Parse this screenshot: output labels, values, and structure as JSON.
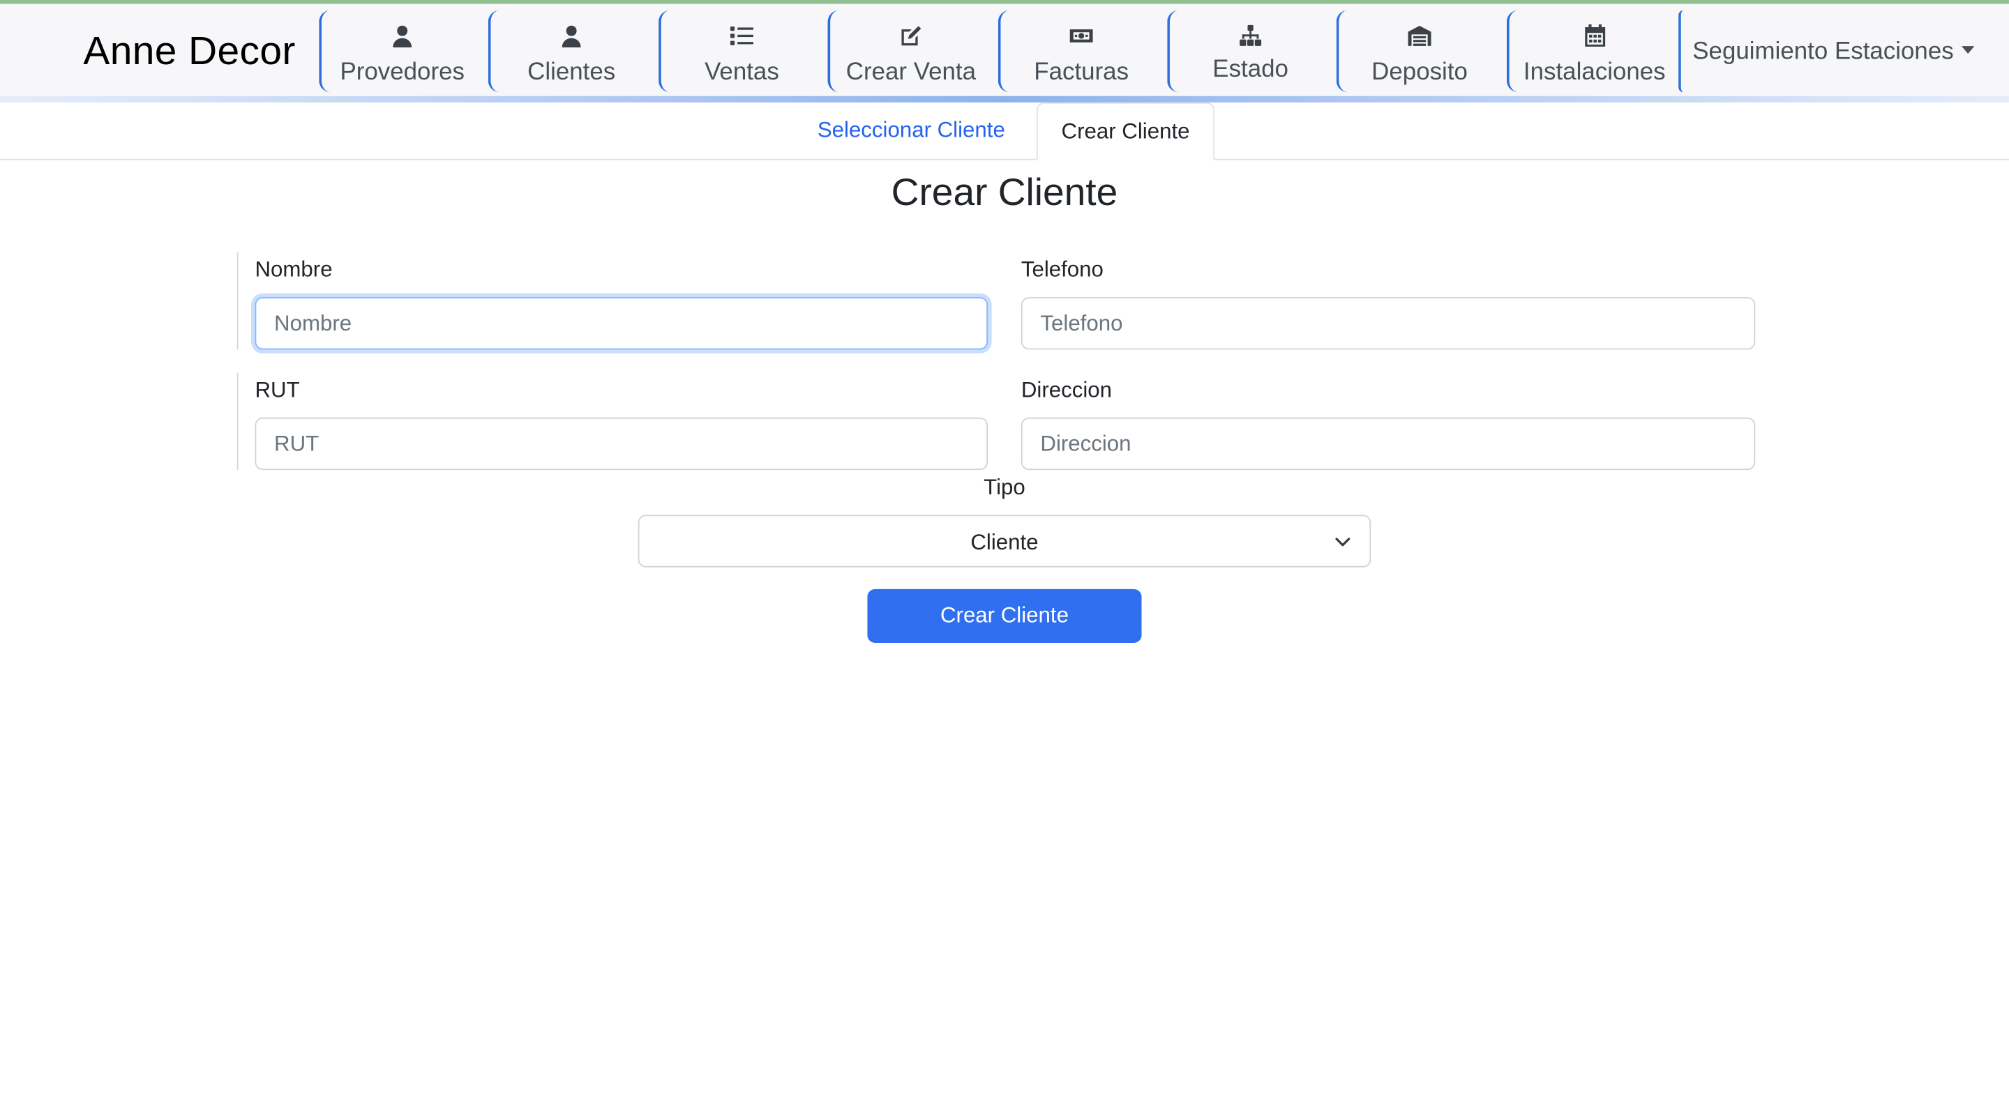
{
  "app": {
    "brand": "Anne Decor"
  },
  "nav": {
    "items": [
      {
        "label": "Provedores",
        "icon": "user-icon"
      },
      {
        "label": "Clientes",
        "icon": "user-icon"
      },
      {
        "label": "Ventas",
        "icon": "list-icon"
      },
      {
        "label": "Crear Venta",
        "icon": "edit-icon"
      },
      {
        "label": "Facturas",
        "icon": "money-bill-icon"
      },
      {
        "label": "Estado",
        "icon": "sitemap-icon"
      },
      {
        "label": "Deposito",
        "icon": "warehouse-icon"
      },
      {
        "label": "Instalaciones",
        "icon": "calendar-icon"
      }
    ],
    "dropdown": {
      "label": "Seguimiento Estaciones",
      "icon": "caret-down-icon"
    }
  },
  "tabs": {
    "items": [
      {
        "label": "Seleccionar Cliente",
        "active": false
      },
      {
        "label": "Crear Cliente",
        "active": true
      }
    ]
  },
  "form": {
    "title": "Crear Cliente",
    "fields": {
      "nombre": {
        "label": "Nombre",
        "placeholder": "Nombre",
        "value": ""
      },
      "telefono": {
        "label": "Telefono",
        "placeholder": "Telefono",
        "value": ""
      },
      "rut": {
        "label": "RUT",
        "placeholder": "RUT",
        "value": ""
      },
      "direccion": {
        "label": "Direccion",
        "placeholder": "Direccion",
        "value": ""
      }
    },
    "tipo": {
      "label": "Tipo",
      "selected": "Cliente"
    },
    "submit_label": "Crear Cliente"
  },
  "colors": {
    "primary": "#2f6ff0",
    "link": "#2563eb",
    "nav_accent": "#2f6fdc",
    "nav_background": "#f7f7f9"
  }
}
